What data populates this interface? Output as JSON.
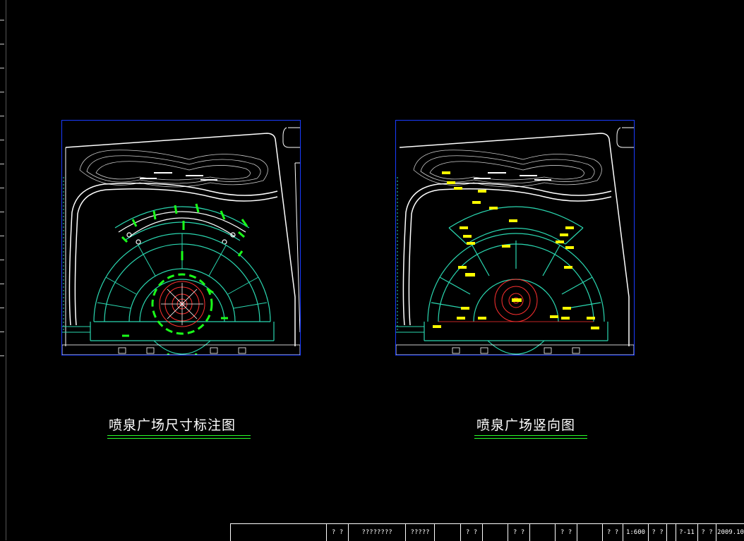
{
  "drawing": {
    "left_view": {
      "title": "喷泉广场尺寸标注图"
    },
    "right_view": {
      "title": "喷泉广场竖向图"
    }
  },
  "title_block": {
    "cells": [
      "? ?",
      "????????",
      "?????",
      "? ?",
      "? ?",
      "? ?",
      "? ?",
      "1:600",
      "? ?",
      "?-11",
      "? ?",
      "2009.10"
    ]
  },
  "colors": {
    "background": "#000000",
    "viewport_border": "#1a3cff",
    "site_outline": "#ffffff",
    "plaza_lines": "#2ad7b0",
    "dimension_green": "#1aff1a",
    "center_red": "#ff3030",
    "elevation_yellow": "#ffff00",
    "underline": "#2aff2a"
  }
}
